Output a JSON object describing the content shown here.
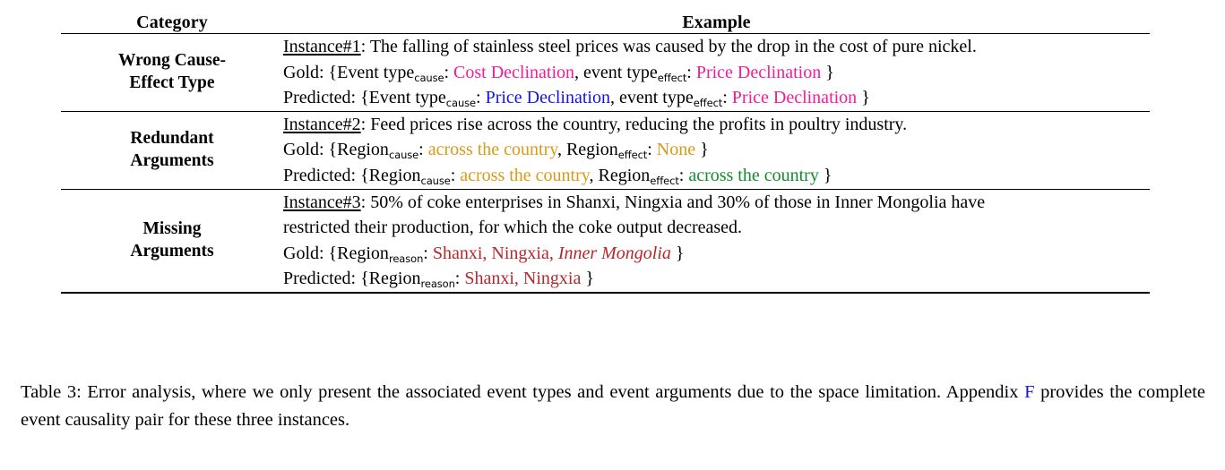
{
  "table": {
    "headers": {
      "category": "Category",
      "example": "Example"
    },
    "rows": [
      {
        "category_line1": "Wrong Cause-",
        "category_line2": "Effect Type",
        "instance_label": "Instance#1",
        "instance_text": ": The falling of stainless steel prices was caused by the drop in the cost of pure nickel.",
        "gold_prefix": "Gold: {Event type",
        "gold_sub1": "cause",
        "gold_mid1": ": ",
        "gold_val1": "Cost Declination",
        "gold_val1_color": "#f51b9c",
        "gold_mid2": ", event type",
        "gold_sub2": "effect",
        "gold_mid3": ": ",
        "gold_val2": "Price Declination",
        "gold_val2_color": "#f51b9c",
        "gold_suffix": " }",
        "pred_prefix": "Predicted: {Event type",
        "pred_sub1": "cause",
        "pred_mid1": ": ",
        "pred_val1": "Price Declination",
        "pred_val1_color": "#1414e6",
        "pred_mid2": ", event type",
        "pred_sub2": "effect",
        "pred_mid3": ": ",
        "pred_val2": "Price Declination",
        "pred_val2_color": "#f51b9c",
        "pred_suffix": " }"
      },
      {
        "category_line1": "Redundant",
        "category_line2": "Arguments",
        "instance_label": "Instance#2",
        "instance_text": ": Feed prices rise across the country, reducing the profits in poultry industry.",
        "gold_prefix": "Gold: {Region",
        "gold_sub1": "cause",
        "gold_mid1": ": ",
        "gold_val1": "across the country",
        "gold_val1_color": "#d79b19",
        "gold_mid2": ", Region",
        "gold_sub2": "effect",
        "gold_mid3": ": ",
        "gold_val2": "None",
        "gold_val2_color": "#d79b19",
        "gold_suffix": " }",
        "pred_prefix": "Predicted: {Region",
        "pred_sub1": "cause",
        "pred_mid1": ": ",
        "pred_val1": "across the country",
        "pred_val1_color": "#d79b19",
        "pred_mid2": ", Region",
        "pred_sub2": "effect",
        "pred_mid3": ": ",
        "pred_val2": "across the country",
        "pred_val2_color": "#16892e",
        "pred_suffix": " }"
      },
      {
        "category_line1": "Missing",
        "category_line2": "Arguments",
        "instance_label": "Instance#3",
        "instance_text": ": 50% of coke enterprises in Shanxi, Ningxia and 30% of those in Inner Mongolia have",
        "instance_text_line2": "restricted their production, for which the coke output decreased.",
        "gold_prefix": "Gold: {Region",
        "gold_sub1": "reason",
        "gold_mid1": ": ",
        "gold_val1": "Shanxi, Ningxia, ",
        "gold_val1_italic": "Inner Mongolia",
        "gold_val1_color": "#b5272d",
        "gold_suffix": " }",
        "pred_prefix": "Predicted: {Region",
        "pred_sub1": "reason",
        "pred_mid1": ": ",
        "pred_val1": "Shanxi, Ningxia",
        "pred_val1_color": "#b5272d",
        "pred_suffix": " }"
      }
    ]
  },
  "caption": {
    "part1": "Table 3: Error analysis, where we only present the associated event types and event arguments due to the space limitation. Appendix ",
    "ref": "F",
    "part2": " provides the complete event causality pair for these three instances."
  }
}
